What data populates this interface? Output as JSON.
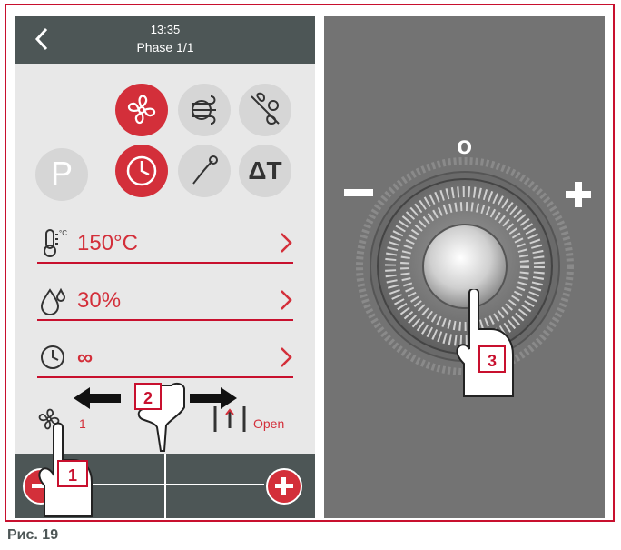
{
  "screen": {
    "time": "13:35",
    "phase": "Phase 1/1",
    "mode_p_label": "P",
    "delta_t_label": "ΔT",
    "rows": [
      {
        "icon": "thermometer-icon",
        "value": "150°C"
      },
      {
        "icon": "humidity-icon",
        "value": "30%"
      },
      {
        "icon": "timer-icon",
        "value": "∞"
      }
    ],
    "fan_speed": "1",
    "valve_label": "Open"
  },
  "knob": {
    "top_label": "o"
  },
  "badges": [
    "1",
    "2",
    "3"
  ],
  "caption": "Рис. 19",
  "colors": {
    "accent_red": "#d32f3a",
    "header_grey": "#4d5656",
    "screen_bg": "#e8e8e8",
    "knob_panel": "#737373"
  }
}
